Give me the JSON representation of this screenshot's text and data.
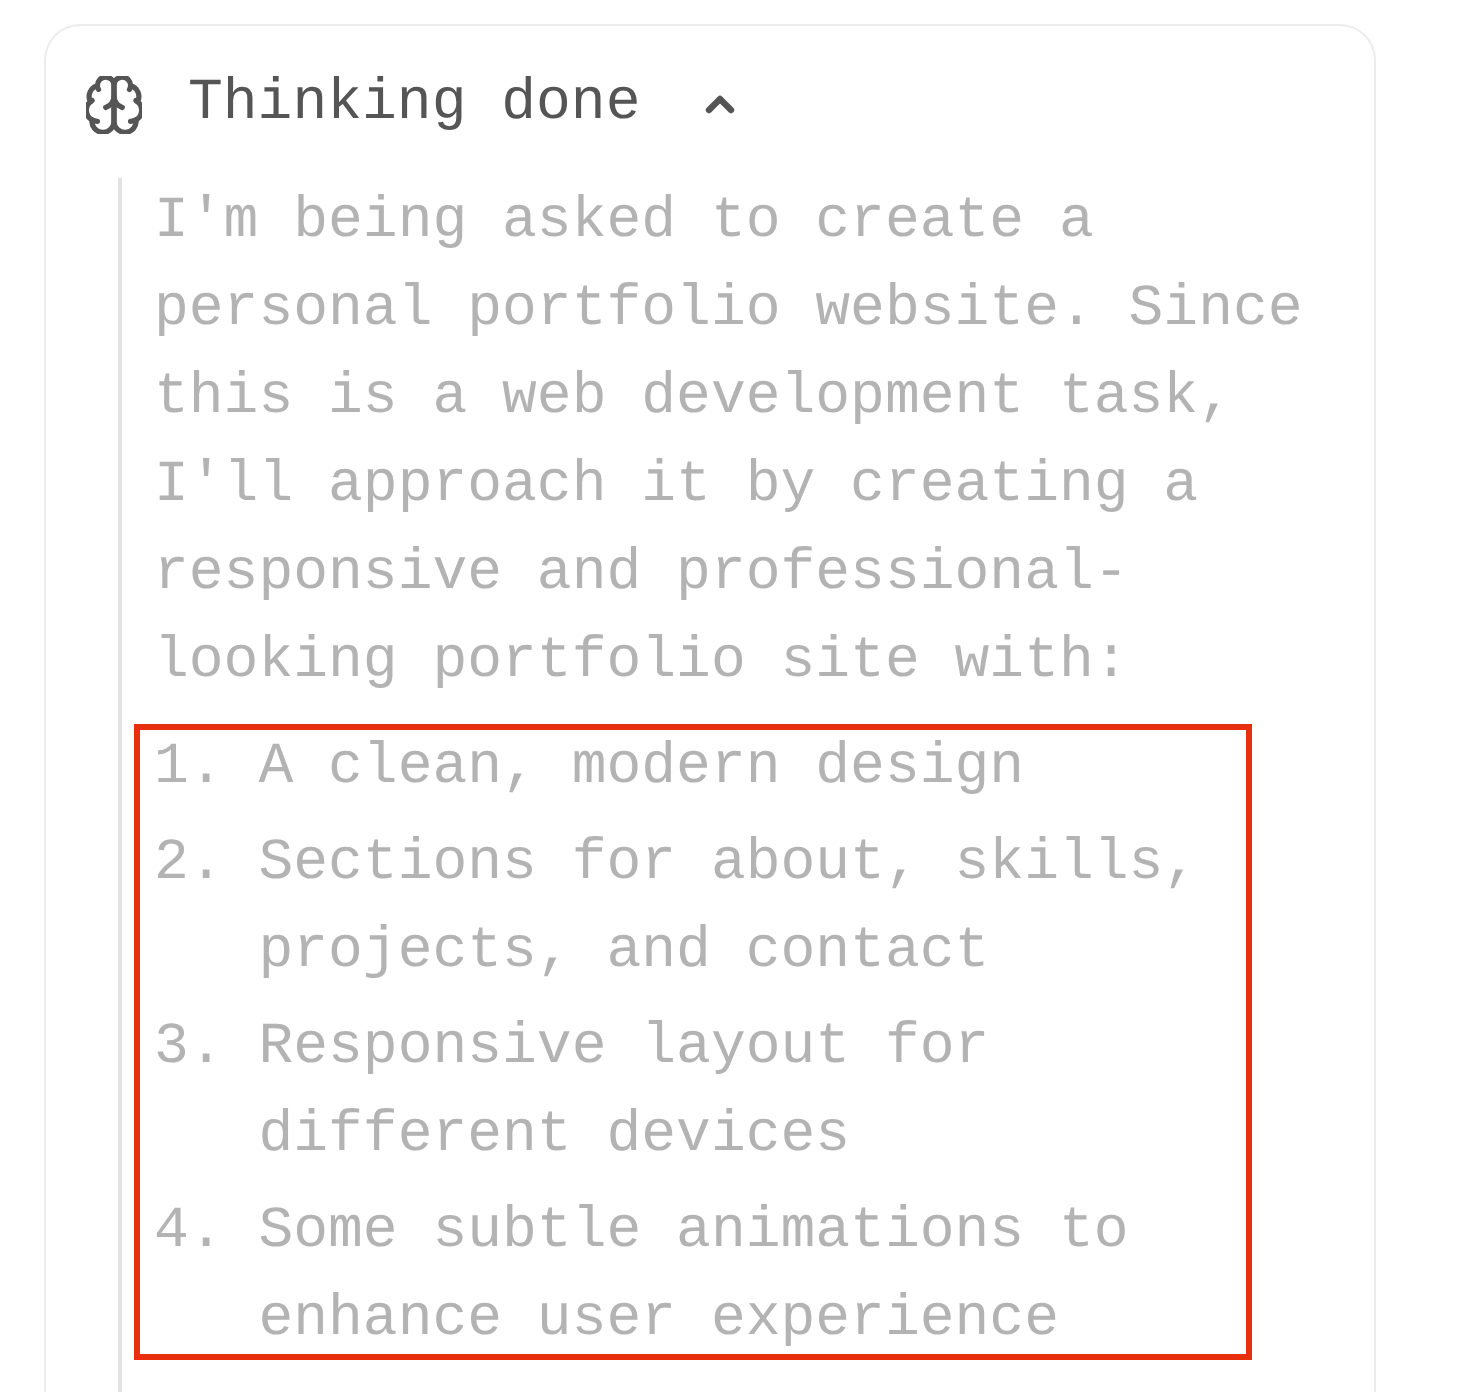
{
  "thinking": {
    "title": "Thinking done",
    "expanded": true,
    "paragraph": "I'm being asked to create a personal portfolio website. Since this is a web development task, I'll approach it by creating a responsive and professional-looking portfolio site with:",
    "list": {
      "highlighted": true,
      "items": [
        {
          "number": "1.",
          "text": "A clean, modern design"
        },
        {
          "number": "2.",
          "text": "Sections for about, skills, projects, and contact"
        },
        {
          "number": "3.",
          "text": "Responsive layout for different devices"
        },
        {
          "number": "4.",
          "text": "Some subtle animations to enhance user experience"
        }
      ]
    }
  }
}
